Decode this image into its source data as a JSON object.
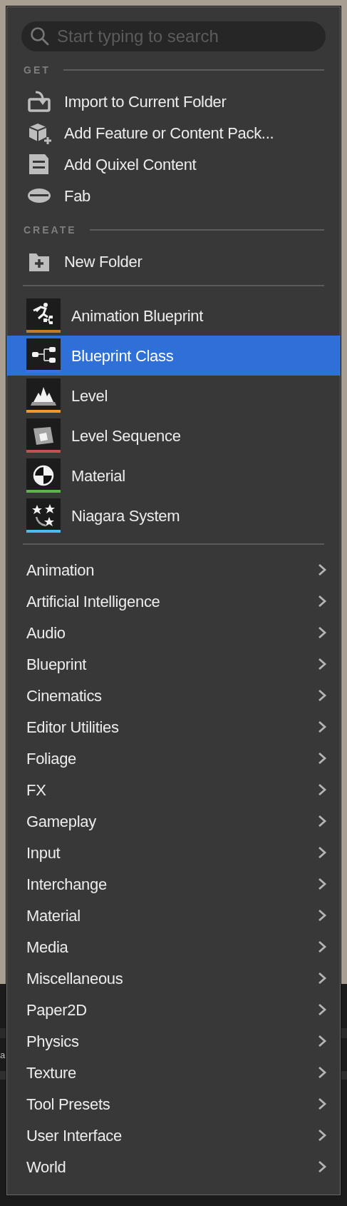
{
  "search": {
    "placeholder": "Start typing to search"
  },
  "sections": [
    {
      "heading": "GET",
      "items": [
        {
          "label": "Import to Current Folder"
        },
        {
          "label": "Add Feature or Content Pack..."
        },
        {
          "label": "Add Quixel Content"
        },
        {
          "label": "Fab"
        }
      ]
    },
    {
      "heading": "CREATE",
      "items": [
        {
          "label": "New Folder"
        }
      ]
    }
  ],
  "assets": [
    {
      "label": "Animation Blueprint",
      "color": "#c27a2c",
      "selected": false
    },
    {
      "label": "Blueprint Class",
      "color": "#3f6fe6",
      "selected": true
    },
    {
      "label": "Level",
      "color": "#ec9a2e",
      "selected": false
    },
    {
      "label": "Level Sequence",
      "color": "#c05252",
      "selected": false
    },
    {
      "label": "Material",
      "color": "#5cb54a",
      "selected": false
    },
    {
      "label": "Niagara System",
      "color": "#4cbcee",
      "selected": false
    }
  ],
  "categories": [
    {
      "label": "Animation"
    },
    {
      "label": "Artificial Intelligence"
    },
    {
      "label": "Audio"
    },
    {
      "label": "Blueprint"
    },
    {
      "label": "Cinematics"
    },
    {
      "label": "Editor Utilities"
    },
    {
      "label": "Foliage"
    },
    {
      "label": "FX"
    },
    {
      "label": "Gameplay"
    },
    {
      "label": "Input"
    },
    {
      "label": "Interchange"
    },
    {
      "label": "Material"
    },
    {
      "label": "Media"
    },
    {
      "label": "Miscellaneous"
    },
    {
      "label": "Paper2D"
    },
    {
      "label": "Physics"
    },
    {
      "label": "Texture"
    },
    {
      "label": "Tool Presets"
    },
    {
      "label": "User Interface"
    },
    {
      "label": "World"
    }
  ],
  "background_text": "a"
}
